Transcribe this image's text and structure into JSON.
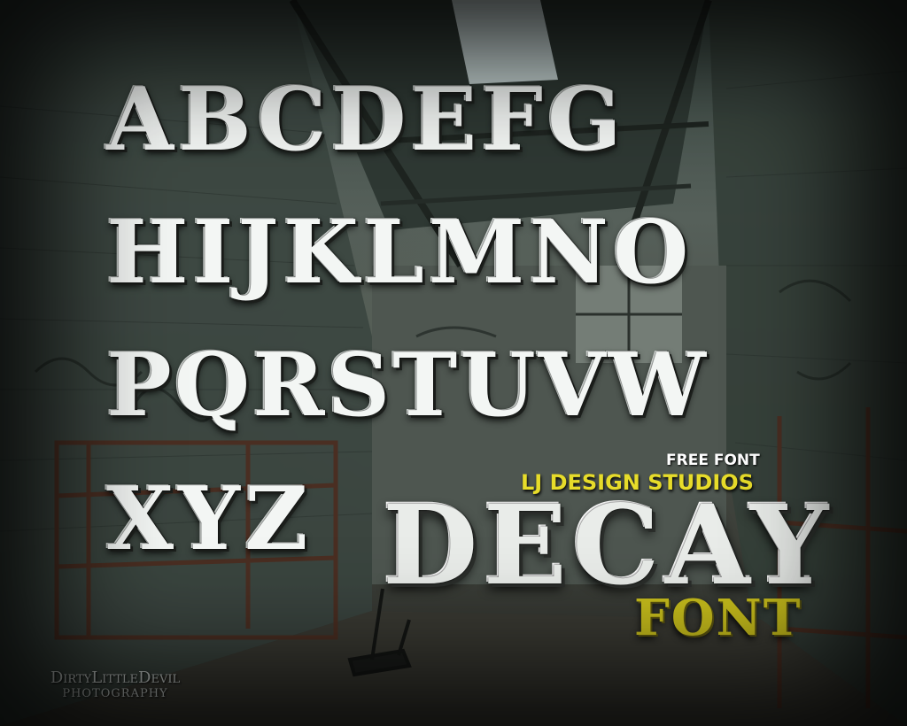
{
  "poster": {
    "alphabet_rows": [
      "ABCDEFG",
      "HIJKLMNO",
      "PQRSTUVW",
      "XYZ"
    ],
    "tag_free": "FREE FONT",
    "studio": "LJ DESIGN STUDIOS",
    "title": "DECAY",
    "subtitle": "FONT",
    "watermark": {
      "name": "DirtyLittleDevil",
      "line2": "PHOTOGRAPHY"
    },
    "colors": {
      "letters": "#f3f6f4",
      "studio_yellow": "#e7dc2a",
      "font_word": "#c9bf1c",
      "scene_dark": "#2f312c"
    }
  }
}
